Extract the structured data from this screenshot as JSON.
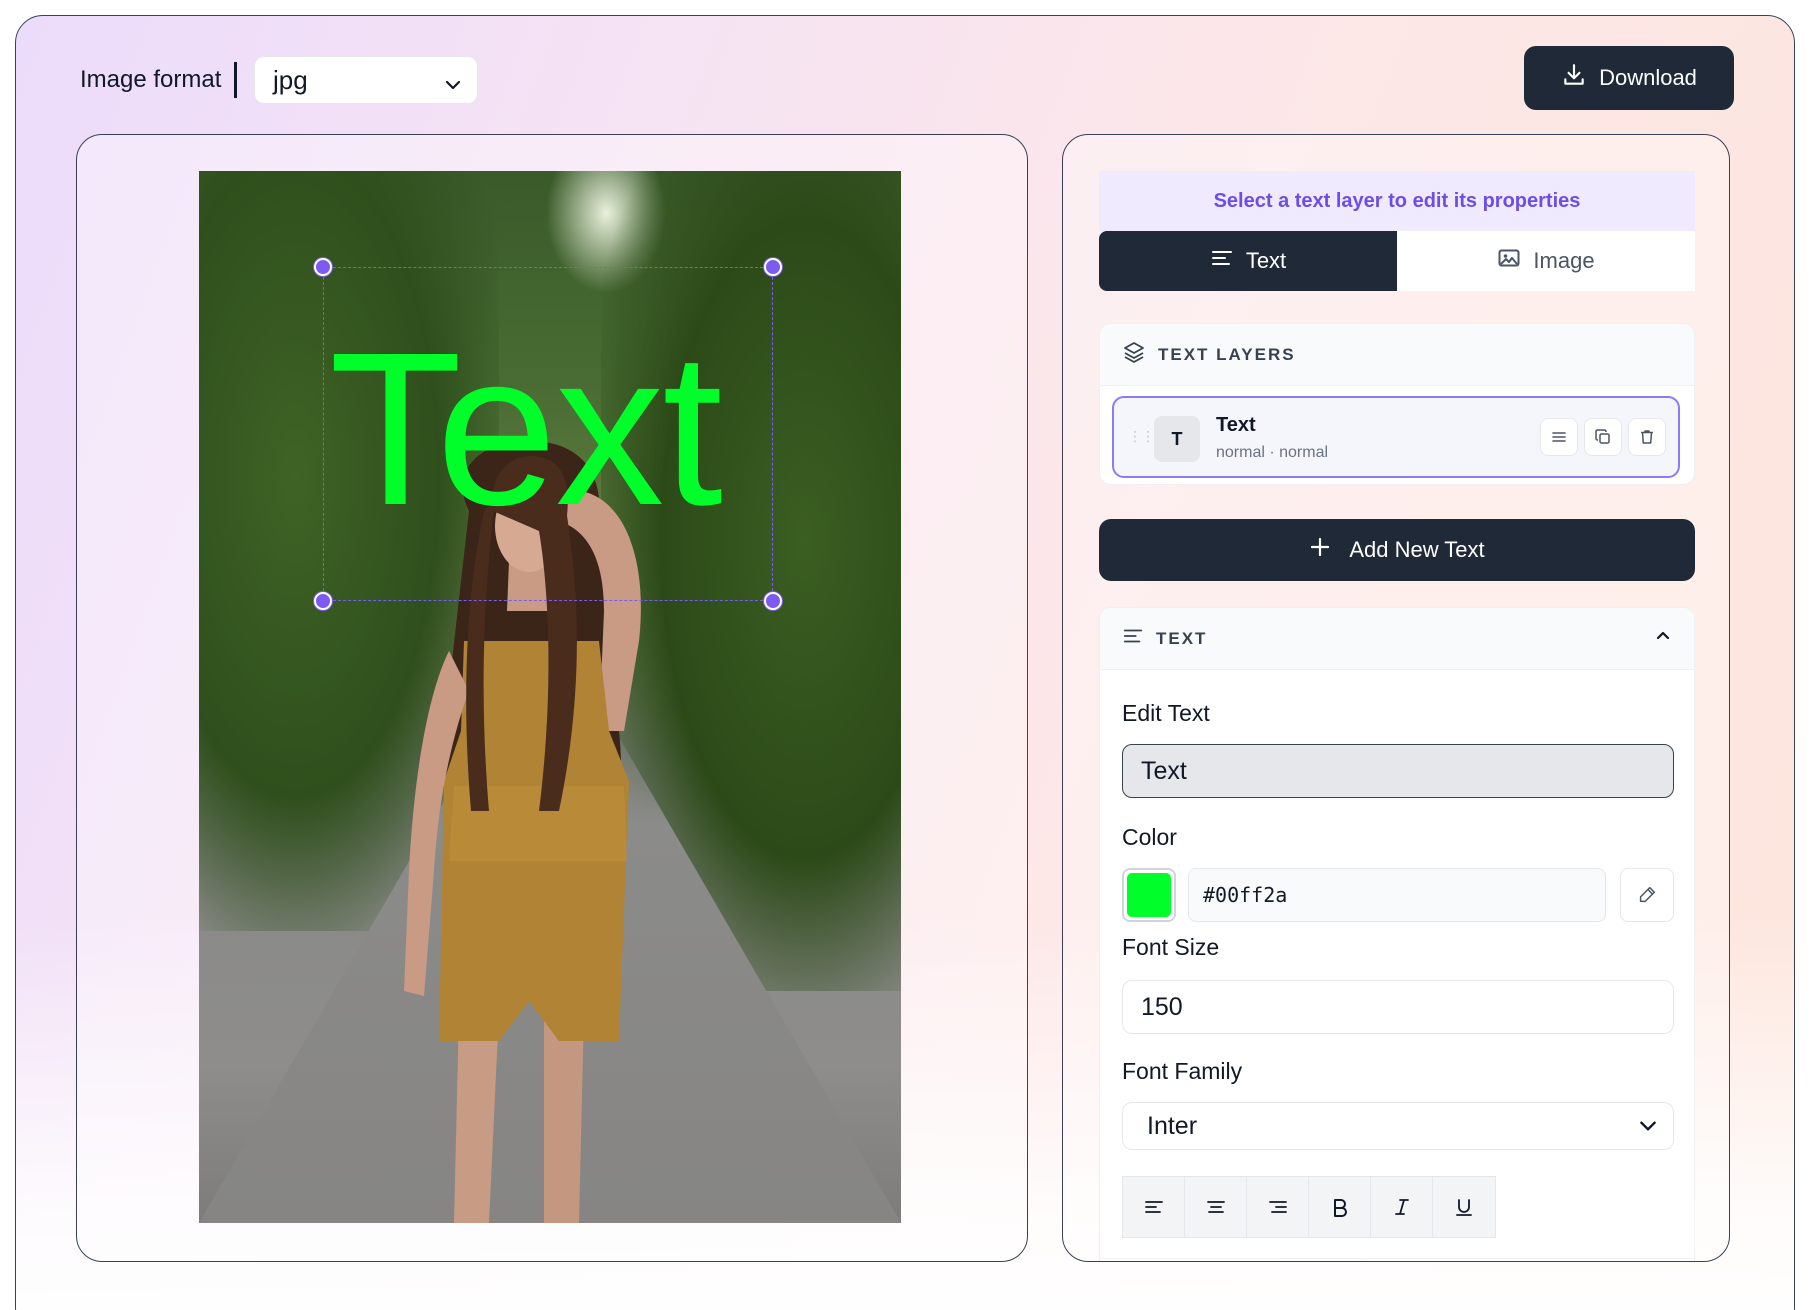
{
  "header": {
    "format_label": "Image format",
    "format_value": "jpg",
    "download_label": "Download"
  },
  "canvas": {
    "overlay_text": "Text",
    "overlay_color": "#00ff2a"
  },
  "panel": {
    "hint": "Select a text layer to edit its properties",
    "tabs": [
      {
        "label": "Text",
        "icon": "text-lines-icon",
        "active": true
      },
      {
        "label": "Image",
        "icon": "image-icon",
        "active": false
      }
    ],
    "layers_title": "TEXT LAYERS",
    "layers": [
      {
        "badge": "T",
        "name": "Text",
        "meta": "normal · normal"
      }
    ],
    "add_label": "Add New Text",
    "props_title": "TEXT",
    "edit_text_label": "Edit Text",
    "edit_text_value": "Text",
    "color_label": "Color",
    "color_value": "#00ff2a",
    "font_size_label": "Font Size",
    "font_size_value": "150",
    "font_family_label": "Font Family",
    "font_family_value": "Inter"
  },
  "colors": {
    "accent": "#7c5cf0",
    "dark": "#1f2937"
  }
}
